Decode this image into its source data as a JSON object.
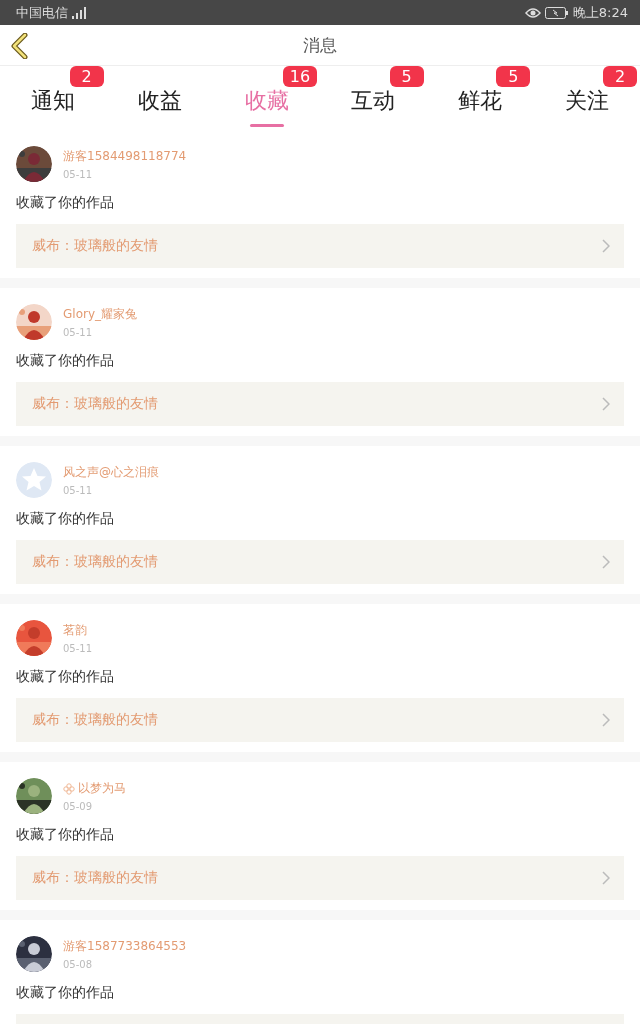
{
  "status_bar": {
    "carrier": "中国电信",
    "time": "晚上8:24"
  },
  "header": {
    "title": "消息"
  },
  "tabs": [
    {
      "label": "通知",
      "badge": "2",
      "selected": false
    },
    {
      "label": "收益",
      "selected": false
    },
    {
      "label": "收藏",
      "badge": "16",
      "selected": true
    },
    {
      "label": "互动",
      "badge": "5",
      "selected": false
    },
    {
      "label": "鲜花",
      "badge": "5",
      "selected": false
    },
    {
      "label": "关注",
      "badge": "2",
      "selected": false
    }
  ],
  "items": [
    {
      "flower": false,
      "name": "游客1584498118774",
      "date": "05-11",
      "action": "收藏了你的作品",
      "work": "威布：玻璃般的友情"
    },
    {
      "flower": false,
      "name": "Glory_耀家兔",
      "date": "05-11",
      "action": "收藏了你的作品",
      "work": "威布：玻璃般的友情"
    },
    {
      "avatar": {
        "kind": "default"
      },
      "flower": false,
      "name": "风之声@心之泪痕",
      "date": "05-11",
      "action": "收藏了你的作品",
      "work": "威布：玻璃般的友情"
    },
    {
      "flower": false,
      "name": "茗韵",
      "date": "05-11",
      "action": "收藏了你的作品",
      "work": "威布：玻璃般的友情"
    },
    {
      "flower": true,
      "name": "以梦为马",
      "date": "05-09",
      "action": "收藏了你的作品",
      "work": "威布：玻璃般的友情"
    },
    {
      "flower": false,
      "name": "游客1587733864553",
      "date": "05-08",
      "action": "收藏了你的作品"
    }
  ]
}
